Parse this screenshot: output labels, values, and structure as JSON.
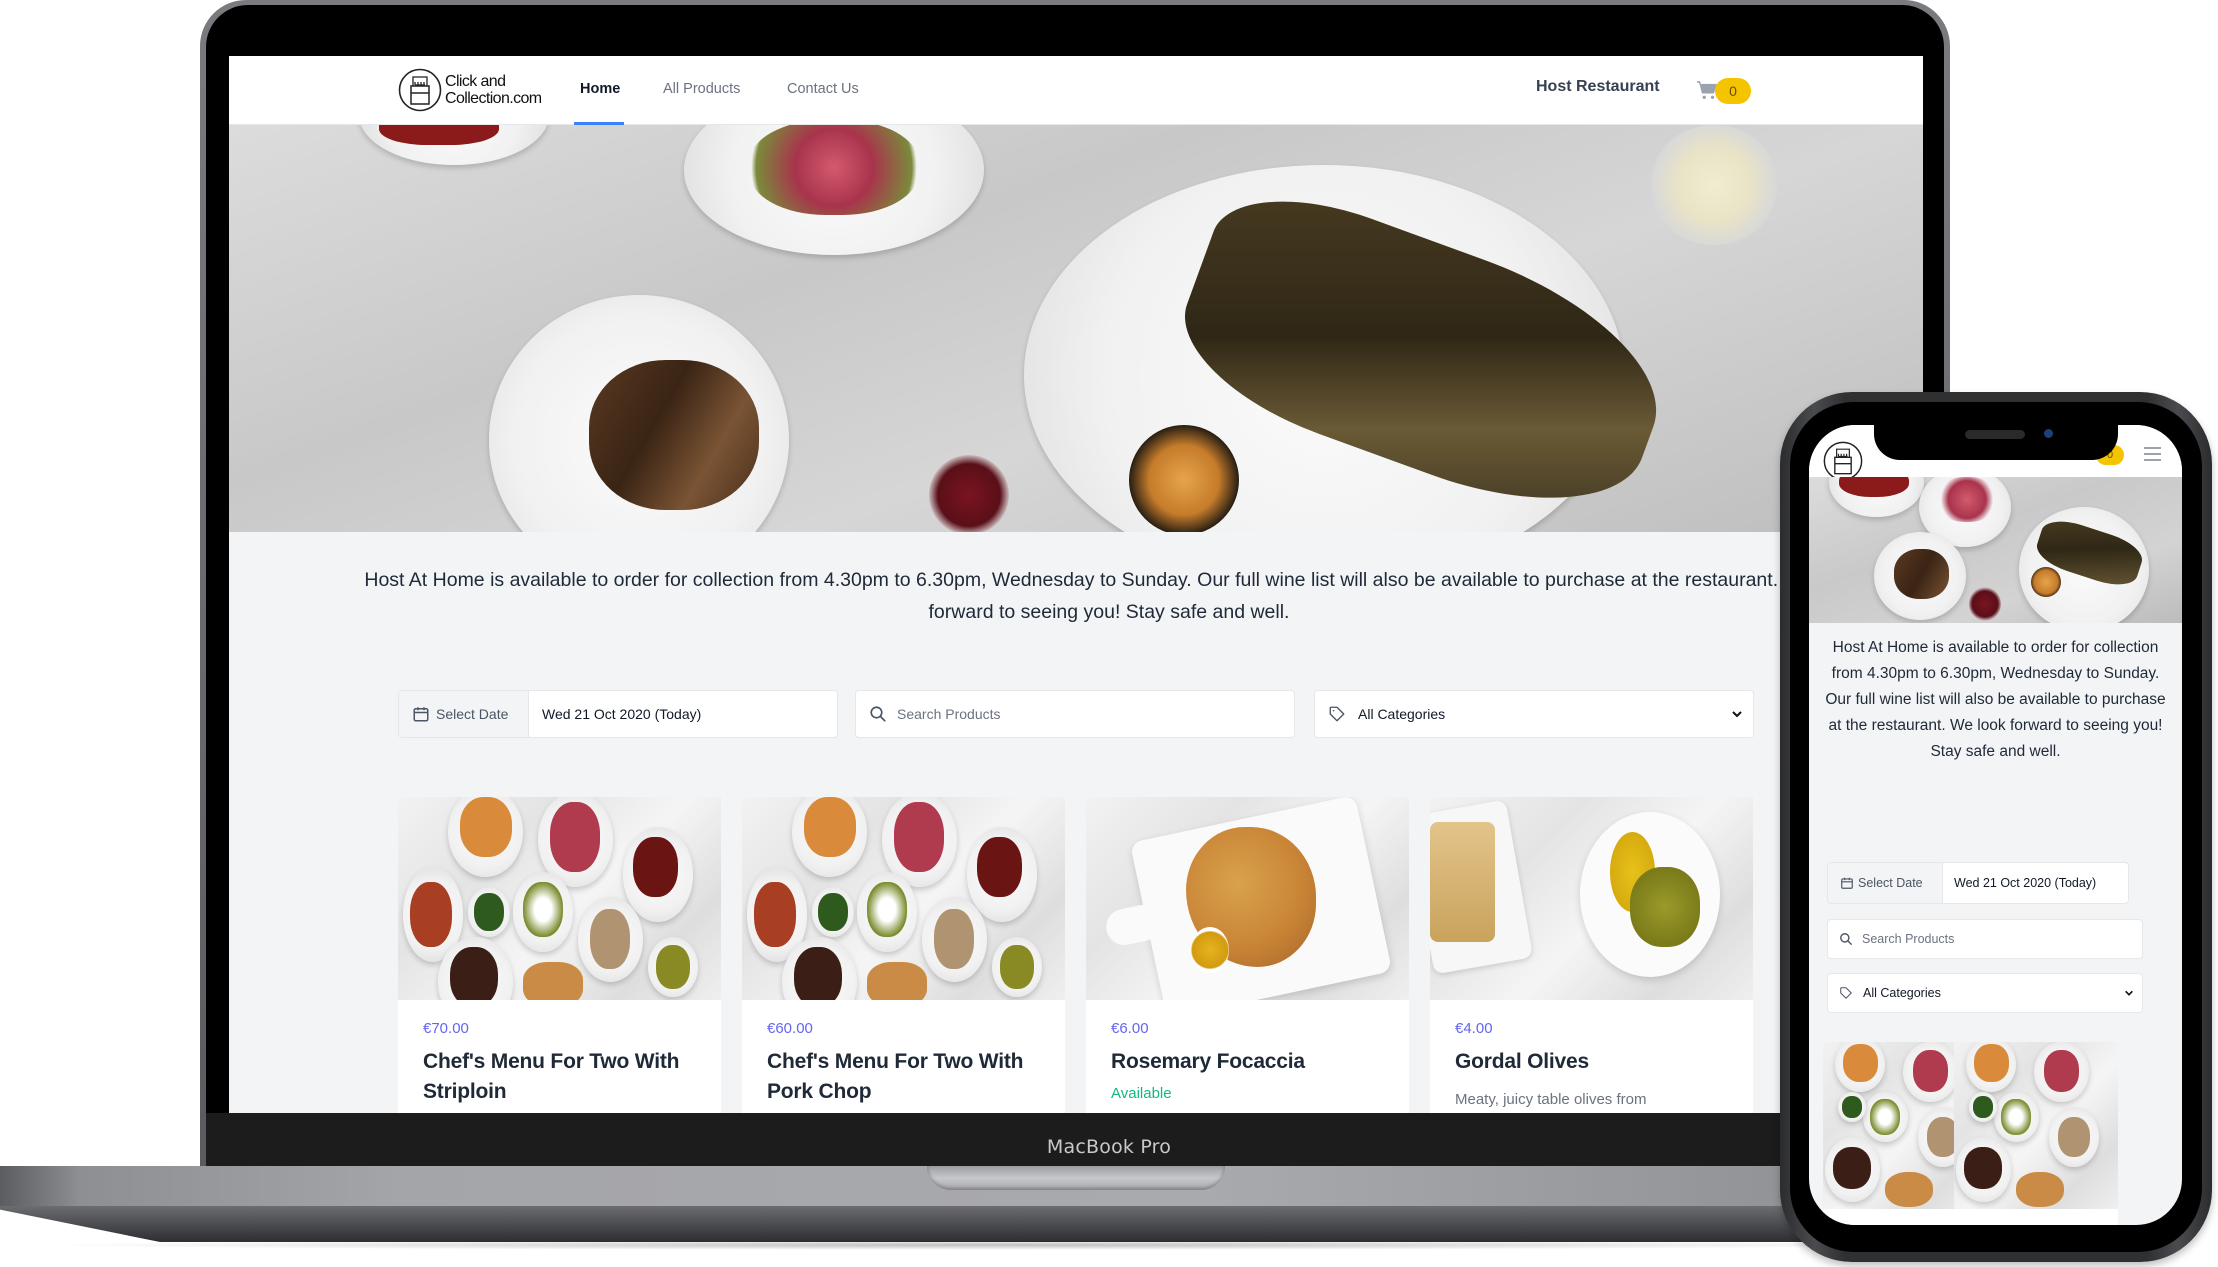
{
  "device_labels": {
    "laptop": "MacBook Pro"
  },
  "site": {
    "logo_text_line1": "Click and",
    "logo_text_line2": "Collection.com",
    "nav": [
      {
        "label": "Home",
        "active": true
      },
      {
        "label": "All Products",
        "active": false
      },
      {
        "label": "Contact Us",
        "active": false
      }
    ],
    "restaurant_name": "Host Restaurant",
    "cart_count": "0",
    "accent_color": "#3b82f6",
    "badge_color": "#f5c400",
    "price_color": "#6366f1",
    "available_color": "#10b981"
  },
  "intro": {
    "line1": "Host At Home is available to order for collection from 4.30pm to 6.30pm, Wednesday to Sunday. Our full wine list will also be available to purchase at the restaurant. We look",
    "line2": "forward to seeing you! Stay safe and well.",
    "full": "Host At Home is available to order for collection from 4.30pm to 6.30pm, Wednesday to Sunday. Our full wine list will also be available to purchase at the restaurant. We look forward to seeing you! Stay safe and well."
  },
  "filters": {
    "date_label": "Select Date",
    "date_value": "Wed 21 Oct 2020 (Today)",
    "search_placeholder": "Search Products",
    "category_selected": "All Categories"
  },
  "products": [
    {
      "price": "€70.00",
      "name_line1": "Chef's Menu For Two With",
      "name_line2": "Striploin",
      "image": "chefs-menu-spread"
    },
    {
      "price": "€60.00",
      "name_line1": "Chef's Menu For Two With",
      "name_line2": "Pork Chop",
      "image": "chefs-menu-spread"
    },
    {
      "price": "€6.00",
      "name_line1": "Rosemary Focaccia",
      "status": "Available",
      "image": "focaccia"
    },
    {
      "price": "€4.00",
      "name_line1": "Gordal Olives",
      "description": "Meaty, juicy table olives from",
      "image": "olives"
    }
  ],
  "icons": {
    "logo": "shopping-bag-logo-icon",
    "cart": "cart-icon",
    "calendar": "calendar-icon",
    "search": "search-icon",
    "tag": "tag-icon",
    "dropdown": "chevron-down-icon",
    "menu": "hamburger-menu-icon"
  }
}
